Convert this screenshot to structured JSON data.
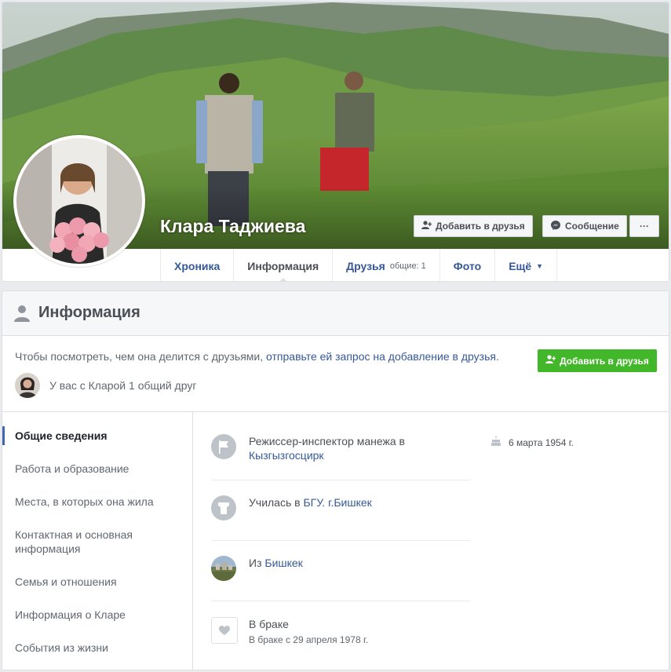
{
  "profile": {
    "name": "Клара Таджиева"
  },
  "cover_actions": {
    "add_friend": "Добавить в друзья",
    "message": "Сообщение",
    "more": "···"
  },
  "tabs": [
    {
      "label": "Хроника"
    },
    {
      "label": "Информация",
      "active": true
    },
    {
      "label": "Друзья",
      "extra": "общие: 1"
    },
    {
      "label": "Фото"
    },
    {
      "label": "Ещё"
    }
  ],
  "info": {
    "title": "Информация",
    "notice_prefix": "Чтобы посмотреть, чем она делится с друзьями,",
    "notice_link": "отправьте ей запрос на добавление в друзья",
    "notice_suffix": ".",
    "add_friend_button": "Добавить в друзья",
    "mutual_friends": "У вас с Кларой 1 общий друг"
  },
  "sidebar": {
    "items": [
      {
        "label": "Общие сведения",
        "active": true
      },
      {
        "label": "Работа и образование"
      },
      {
        "label": "Места, в которых она жила"
      },
      {
        "label": "Контактная и основная информация"
      },
      {
        "label": "Семья и отношения"
      },
      {
        "label": "Информация о Кларе"
      },
      {
        "label": "События из жизни"
      }
    ]
  },
  "overview": {
    "work_prefix": "Режиссер-инспектор манежа в",
    "work_link": "Кызгызгосцирк",
    "edu_prefix": "Училась в",
    "edu_link": "БГУ. г.Бишкек",
    "from_prefix": "Из",
    "from_link": "Бишкек",
    "relationship": "В браке",
    "relationship_sub": "В браке с 29 апреля 1978 г.",
    "birthday": "6 марта 1954 г."
  },
  "colors": {
    "accent": "#4267b2",
    "link": "#365899",
    "green_button": "#42b72a"
  }
}
